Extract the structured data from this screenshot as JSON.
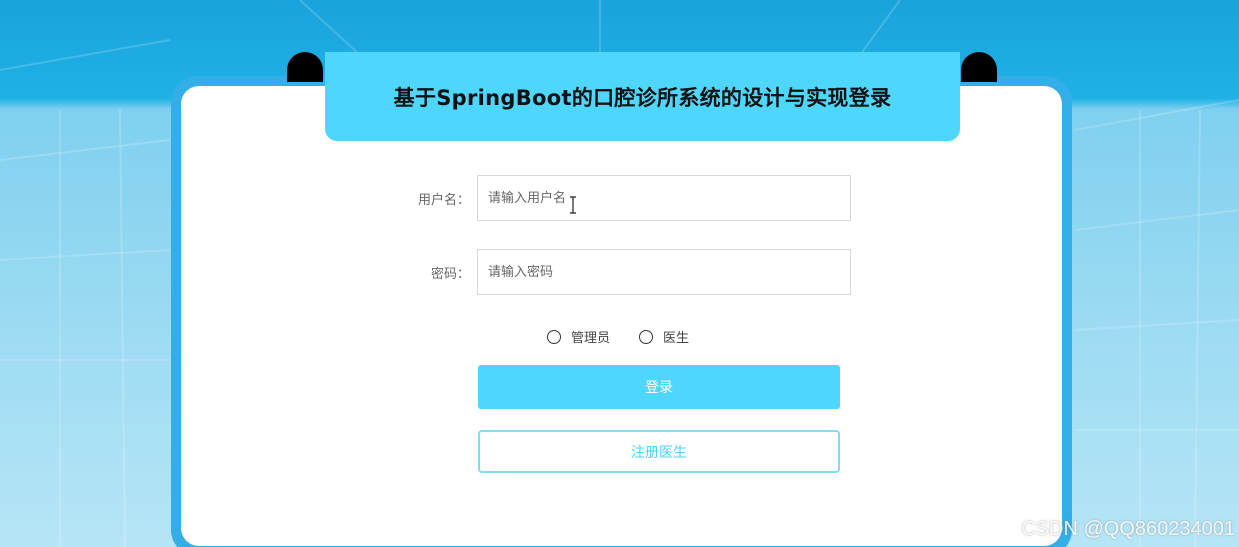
{
  "title": "基于SpringBoot的口腔诊所系统的设计与实现登录",
  "form": {
    "username": {
      "label": "用户名：",
      "placeholder": "请输入用户名"
    },
    "password": {
      "label": "密码：",
      "placeholder": "请输入密码"
    },
    "roles": [
      {
        "label": "管理员",
        "selected": false
      },
      {
        "label": "医生",
        "selected": false
      }
    ],
    "login_label": "登录",
    "register_label": "注册医生"
  },
  "watermark": "CSDN @QQ860234001",
  "colors": {
    "banner": "#4fd6fc",
    "card_border": "#33aee6",
    "login_button": "#4fd6fc",
    "register_border": "#82dcf5"
  }
}
